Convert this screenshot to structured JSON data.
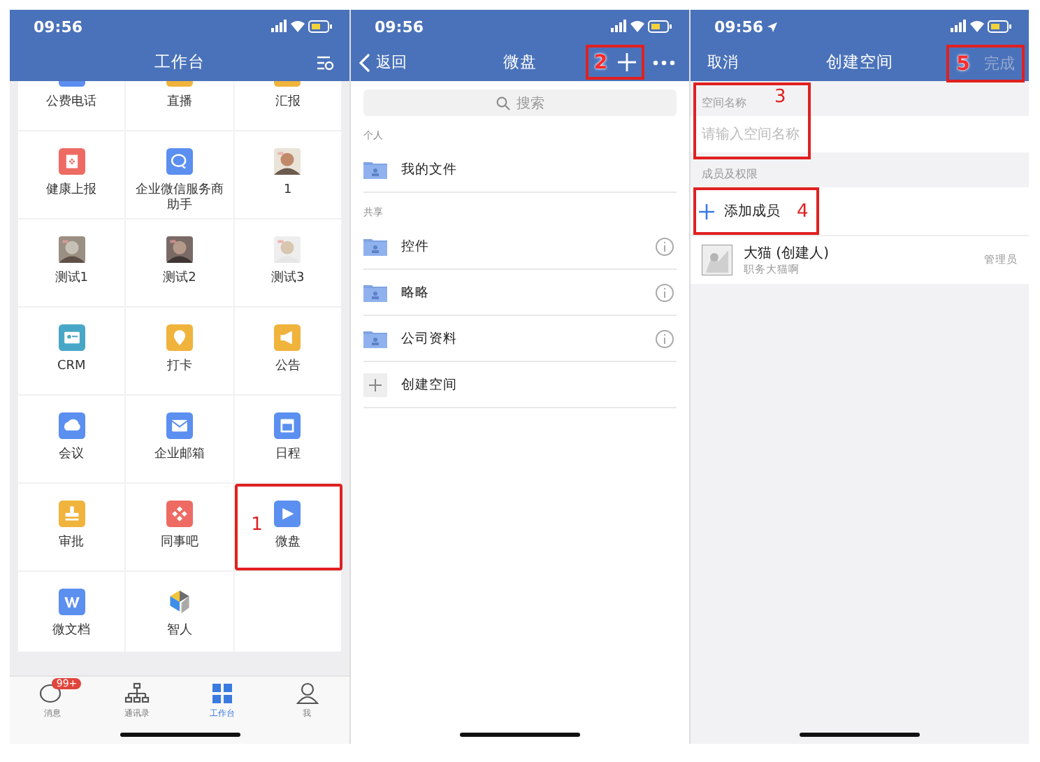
{
  "workbench": {
    "time": "09:56",
    "title": "工作台",
    "apps": [
      {
        "label": "公费电话",
        "kind": "phone",
        "color": "#5b8ff0"
      },
      {
        "label": "直播",
        "kind": "live",
        "color": "#f0b33c"
      },
      {
        "label": "汇报",
        "kind": "report",
        "color": "#f0b33c"
      },
      {
        "label": "健康上报",
        "kind": "health",
        "color": "#ee6b63"
      },
      {
        "label": "企业微信服务商助手",
        "kind": "chat",
        "color": "#5b8ff0"
      },
      {
        "label": "1",
        "kind": "picture"
      },
      {
        "label": "测试1",
        "kind": "picture"
      },
      {
        "label": "测试2",
        "kind": "picture"
      },
      {
        "label": "测试3",
        "kind": "picture"
      },
      {
        "label": "CRM",
        "kind": "card",
        "color": "#48a7c7"
      },
      {
        "label": "打卡",
        "kind": "pin",
        "color": "#f0b33c"
      },
      {
        "label": "公告",
        "kind": "megaphone",
        "color": "#f0b33c"
      },
      {
        "label": "会议",
        "kind": "meeting",
        "color": "#5b8ff0"
      },
      {
        "label": "企业邮箱",
        "kind": "mail",
        "color": "#5b8ff0"
      },
      {
        "label": "日程",
        "kind": "calendar",
        "color": "#5b8ff0"
      },
      {
        "label": "审批",
        "kind": "stamp",
        "color": "#f0b33c"
      },
      {
        "label": "同事吧",
        "kind": "share",
        "color": "#ee6b63"
      },
      {
        "label": "微盘",
        "kind": "drive",
        "color": "#5b8ff0",
        "annotation": "1"
      },
      {
        "label": "微文档",
        "kind": "doc",
        "color": "#5b8ff0"
      },
      {
        "label": "智人",
        "kind": "cube"
      }
    ],
    "tabs": [
      {
        "label": "消息",
        "kind": "chat",
        "badge": "99+",
        "selected": false
      },
      {
        "label": "通讯录",
        "kind": "org",
        "selected": false
      },
      {
        "label": "工作台",
        "kind": "grid",
        "selected": true
      },
      {
        "label": "我",
        "kind": "person",
        "selected": false
      }
    ]
  },
  "drive": {
    "time": "09:56",
    "back": "返回",
    "title": "微盘",
    "annotation": "2",
    "search": {
      "placeholder": "搜索"
    },
    "sections": [
      {
        "title": "个人",
        "items": [
          {
            "name": "我的文件",
            "info": false
          }
        ]
      },
      {
        "title": "共享",
        "items": [
          {
            "name": "控件",
            "info": true
          },
          {
            "name": "略略",
            "info": true
          },
          {
            "name": "公司资料",
            "info": true
          }
        ]
      }
    ],
    "create": "创建空间"
  },
  "create_space": {
    "time": "09:56",
    "cancel": "取消",
    "title": "创建空间",
    "done": {
      "label": "完成",
      "disabled": true,
      "annotation": "5"
    },
    "name_label": "空间名称",
    "name_annotation": "3",
    "name_field": {
      "placeholder": "请输入空间名称"
    },
    "members_label": "成员及权限",
    "add_member": {
      "label": "添加成员",
      "annotation": "4"
    },
    "members": [
      {
        "name": "大猫 (创建人)",
        "subtitle": "职务大猫啊",
        "role": "管理员"
      }
    ]
  }
}
